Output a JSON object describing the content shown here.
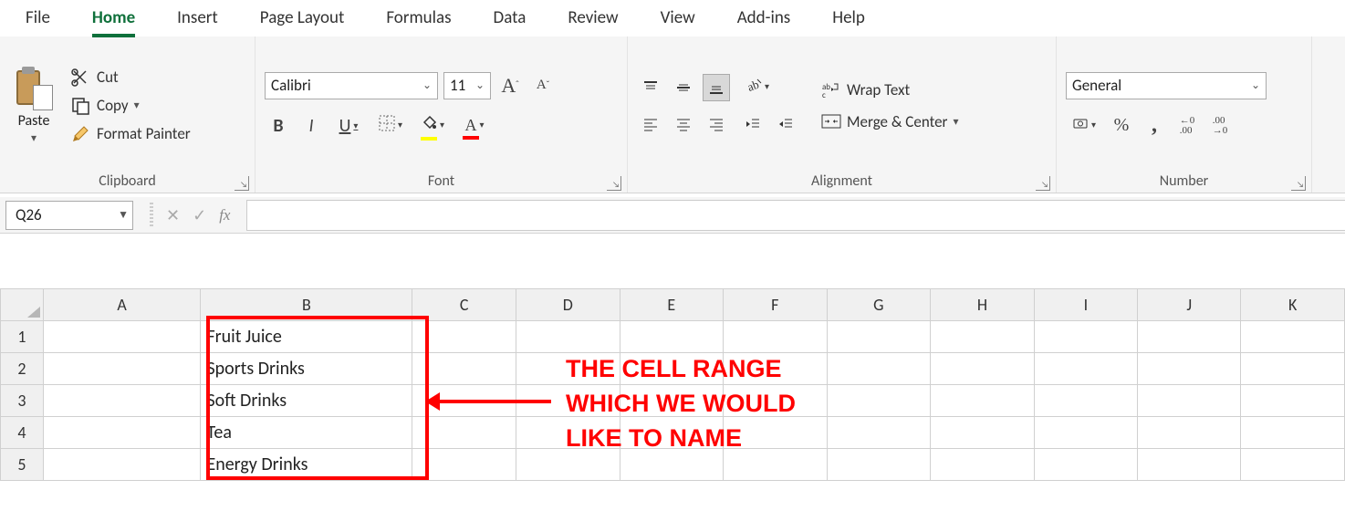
{
  "tabs": {
    "file": "File",
    "home": "Home",
    "insert": "Insert",
    "page_layout": "Page Layout",
    "formulas": "Formulas",
    "data": "Data",
    "review": "Review",
    "view": "View",
    "addins": "Add-ins",
    "help": "Help"
  },
  "clipboard": {
    "paste": "Paste",
    "cut": "Cut",
    "copy": "Copy",
    "format_painter": "Format Painter",
    "group_label": "Clipboard"
  },
  "font": {
    "name": "Calibri",
    "size": "11",
    "increase": "A",
    "decrease": "A",
    "bold": "B",
    "italic": "I",
    "underline": "U",
    "font_color_letter": "A",
    "group_label": "Font"
  },
  "alignment": {
    "wrap": "Wrap Text",
    "merge": "Merge & Center",
    "group_label": "Alignment"
  },
  "number": {
    "format": "General",
    "percent": "%",
    "comma": ",",
    "group_label": "Number"
  },
  "name_box": "Q26",
  "fx_label": "fx",
  "formula_value": "",
  "columns": [
    "A",
    "B",
    "C",
    "D",
    "E",
    "F",
    "G",
    "H",
    "I",
    "J",
    "K"
  ],
  "rows": [
    {
      "num": "1",
      "b": "Fruit Juice"
    },
    {
      "num": "2",
      "b": "Sports Drinks"
    },
    {
      "num": "3",
      "b": "Soft Drinks"
    },
    {
      "num": "4",
      "b": "Tea"
    },
    {
      "num": "5",
      "b": "Energy Drinks"
    }
  ],
  "annotation": {
    "line1": "THE CELL RANGE",
    "line2": "WHICH WE WOULD",
    "line3": "LIKE TO NAME"
  }
}
